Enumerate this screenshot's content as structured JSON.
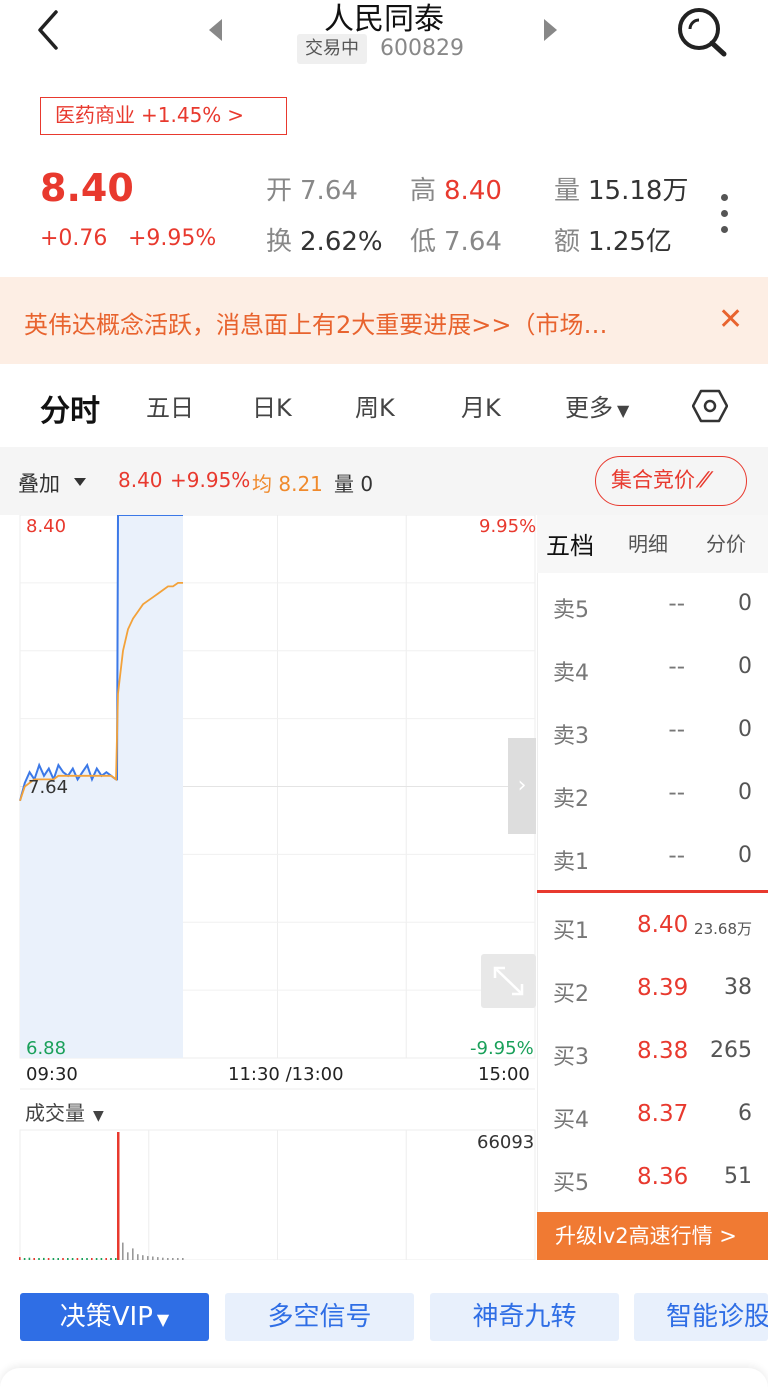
{
  "header": {
    "title": "人民同泰",
    "status": "交易中",
    "code": "600829"
  },
  "sector": {
    "name": "医药商业",
    "change": "+1.45%"
  },
  "quote": {
    "price": "8.40",
    "change": "+0.76",
    "change_pct": "+9.95%",
    "stats": [
      {
        "label": "开",
        "value": "7.64",
        "color": "#888888"
      },
      {
        "label": "高",
        "value": "8.40",
        "color": "#e8392e"
      },
      {
        "label": "量",
        "value": "15.18万",
        "color": "#333333"
      },
      {
        "label": "换",
        "value": "2.62%",
        "color": "#333333"
      },
      {
        "label": "低",
        "value": "7.64",
        "color": "#888888"
      },
      {
        "label": "额",
        "value": "1.25亿",
        "color": "#333333"
      }
    ]
  },
  "banner": {
    "text": "英伟达概念活跃，消息面上有2大重要进展>>（市场…"
  },
  "tabs": [
    "分时",
    "五日",
    "日K",
    "周K",
    "月K",
    "更多"
  ],
  "overlay": {
    "label": "叠加",
    "price": "8.40",
    "pct": "+9.95%",
    "avg_label": "均",
    "avg": "8.21",
    "vol_label": "量",
    "vol": "0",
    "auction": "集合竞价"
  },
  "chart": {
    "y_max": "8.40",
    "y_min": "6.88",
    "y_mid": "7.64",
    "pct_max": "9.95%",
    "pct_min": "-9.95%",
    "t_start": "09:30",
    "t_mid": "11:30 /13:00",
    "t_end": "15:00",
    "volume_label": "成交量",
    "volume_max": "66093"
  },
  "chart_data": {
    "type": "line",
    "title": "",
    "ylim": [
      6.88,
      8.4
    ],
    "series": [
      {
        "values": [
          7.6,
          7.65,
          7.68,
          7.66,
          7.7,
          7.67,
          7.69,
          7.66,
          7.7,
          7.68,
          7.67,
          7.69,
          7.66,
          7.68,
          7.7,
          7.66,
          7.69,
          7.67,
          7.68,
          7.67,
          7.66,
          8.4,
          8.4,
          8.4,
          8.4,
          8.4,
          8.4,
          8.4,
          8.4,
          8.4,
          8.4,
          8.4,
          8.4,
          8.4,
          8.4
        ]
      },
      {
        "values": [
          7.6,
          7.64,
          7.65,
          7.66,
          7.66,
          7.66,
          7.66,
          7.66,
          7.67,
          7.67,
          7.67,
          7.67,
          7.67,
          7.67,
          7.67,
          7.67,
          7.67,
          7.67,
          7.67,
          7.67,
          7.66,
          7.9,
          8.02,
          8.08,
          8.11,
          8.13,
          8.15,
          8.16,
          8.17,
          8.18,
          8.19,
          8.2,
          8.2,
          8.21,
          8.21
        ]
      }
    ],
    "volume": [
      1500,
      900,
      1200,
      800,
      700,
      1100,
      900,
      600,
      800,
      700,
      500,
      900,
      600,
      500,
      700,
      600,
      800,
      500,
      600,
      400,
      700,
      66093,
      9000,
      4000,
      6000,
      3000,
      2500,
      2000,
      1800,
      1500,
      1200,
      1000,
      900,
      800,
      700
    ]
  },
  "orderbook": {
    "tabs": [
      "五档",
      "明细",
      "分价"
    ],
    "sell": [
      {
        "name": "卖5",
        "price": "--",
        "vol": "0"
      },
      {
        "name": "卖4",
        "price": "--",
        "vol": "0"
      },
      {
        "name": "卖3",
        "price": "--",
        "vol": "0"
      },
      {
        "name": "卖2",
        "price": "--",
        "vol": "0"
      },
      {
        "name": "卖1",
        "price": "--",
        "vol": "0"
      }
    ],
    "buy": [
      {
        "name": "买1",
        "price": "8.40",
        "vol": "23.68万"
      },
      {
        "name": "买2",
        "price": "8.39",
        "vol": "38"
      },
      {
        "name": "买3",
        "price": "8.38",
        "vol": "265"
      },
      {
        "name": "买4",
        "price": "8.37",
        "vol": "6"
      },
      {
        "name": "买5",
        "price": "8.36",
        "vol": "51"
      }
    ],
    "upgrade": "升级lv2高速行情 >"
  },
  "buttons": [
    "决策VIP",
    "多空信号",
    "神奇九转",
    "智能诊股"
  ]
}
